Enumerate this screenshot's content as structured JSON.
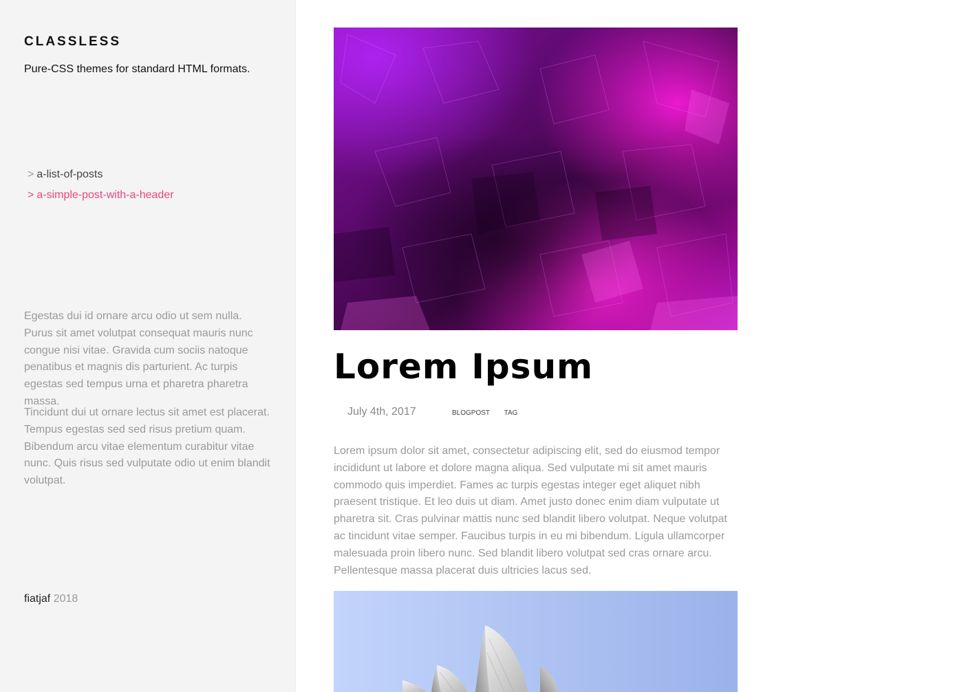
{
  "sidebar": {
    "title": "CLASSLESS",
    "tagline": "Pure-CSS themes for standard HTML formats.",
    "nav": [
      {
        "arrow": ">",
        "label": "a-list-of-posts",
        "active": false
      },
      {
        "arrow": ">",
        "label": "a-simple-post-with-a-header",
        "active": true
      }
    ],
    "paragraphs": [
      "Egestas dui id ornare arcu odio ut sem nulla. Purus sit amet volutpat consequat mauris nunc congue nisi vitae. Gravida cum sociis natoque penatibus et magnis dis parturient. Ac turpis egestas sed tempus urna et pharetra pharetra massa.",
      "Tincidunt dui ut ornare lectus sit amet est placerat. Tempus egestas sed sed risus pretium quam. Bibendum arcu vitae elementum curabitur vitae nunc. Quis risus sed vulputate odio ut enim blandit volutpat."
    ],
    "footer": {
      "author": "fiatjaf",
      "year": "2018"
    }
  },
  "post": {
    "title": "Lorem Ipsum",
    "date": "July 4th, 2017",
    "tags": [
      "BLOGPOST",
      "TAG"
    ],
    "body": "Lorem ipsum dolor sit amet, consectetur adipiscing elit, sed do eiusmod tempor incididunt ut labore et dolore magna aliqua. Sed vulputate mi sit amet mauris commodo quis imperdiet. Fames ac turpis egestas integer eget aliquet nibh praesent tristique. Et leo duis ut diam. Amet justo donec enim diam vulputate ut pharetra sit. Cras pulvinar mattis nunc sed blandit libero volutpat. Neque volutpat ac tincidunt vitae semper. Faucibus turpis in eu mi bibendum. Ligula ullamcorper malesuada proin libero nunc. Sed blandit libero volutpat sed cras ornare arcu. Pellentesque massa placerat duis ultricies lacus sed."
  },
  "colors": {
    "accent": "#e8467c",
    "sidebar_bg": "#f4f4f4",
    "muted_text": "#9a9a9a"
  }
}
